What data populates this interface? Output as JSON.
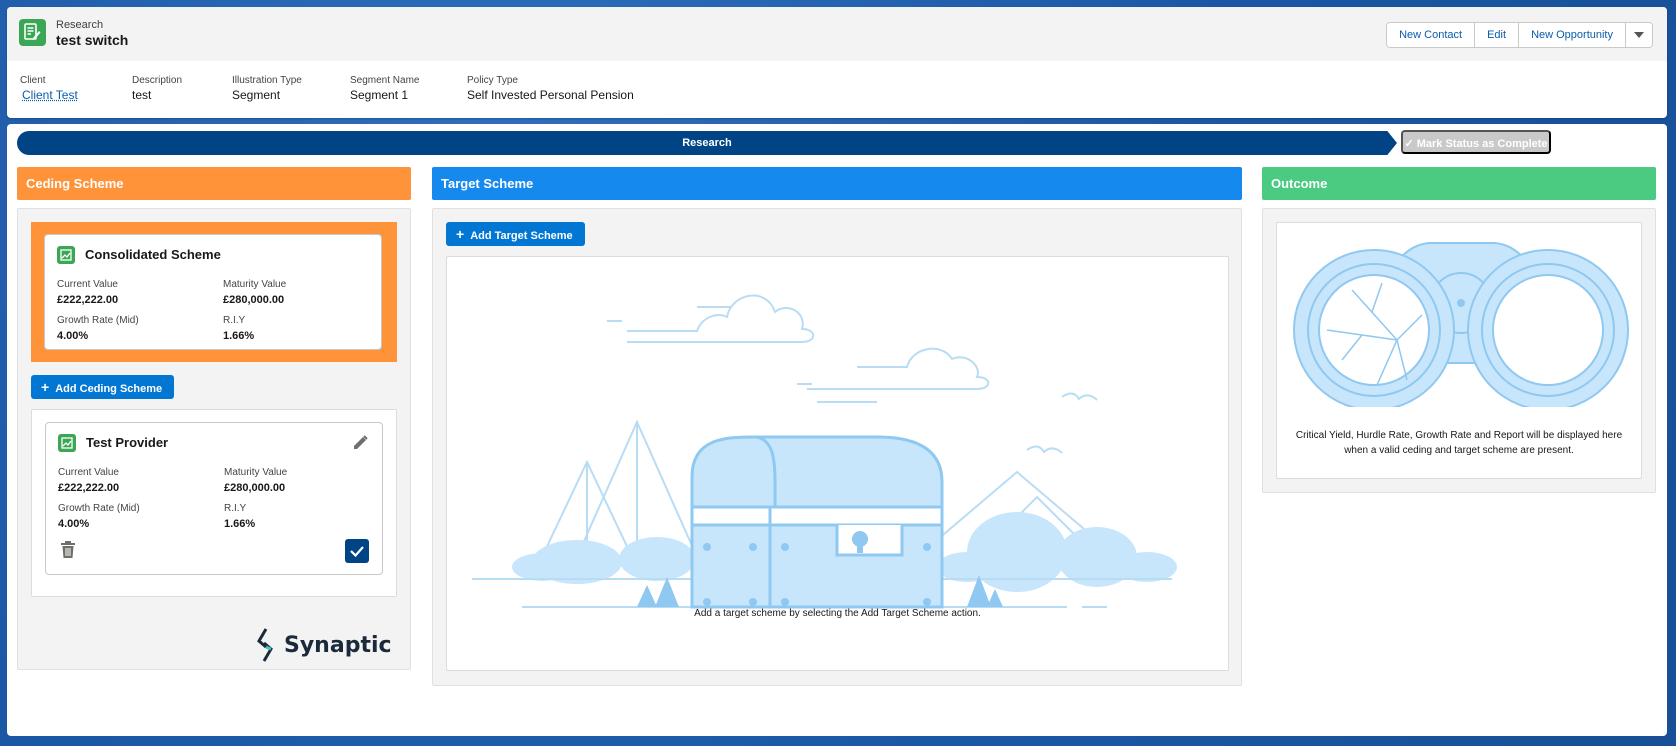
{
  "header": {
    "object_type": "Research",
    "record_name": "test switch",
    "actions": [
      "New Contact",
      "Edit",
      "New Opportunity"
    ],
    "fields": [
      {
        "label": "Client",
        "value": "Client Test"
      },
      {
        "label": "Description",
        "value": "test"
      },
      {
        "label": "Illustration Type",
        "value": "Segment"
      },
      {
        "label": "Segment Name",
        "value": "Segment 1"
      },
      {
        "label": "Policy Type",
        "value": "Self Invested Personal Pension"
      }
    ]
  },
  "path": {
    "current_stage": "Research",
    "mark_complete_label": "Mark Status as Complete"
  },
  "ceding": {
    "title": "Ceding Scheme",
    "add_label": "Add Ceding Scheme",
    "consolidated": {
      "title": "Consolidated Scheme",
      "current_value_label": "Current Value",
      "current_value": "£222,222.00",
      "maturity_value_label": "Maturity Value",
      "maturity_value": "£280,000.00",
      "growth_rate_label": "Growth Rate (Mid)",
      "growth_rate": "4.00%",
      "riy_label": "R.I.Y",
      "riy": "1.66%"
    },
    "provider": {
      "title": "Test Provider",
      "current_value_label": "Current Value",
      "current_value": "£222,222.00",
      "maturity_value_label": "Maturity Value",
      "maturity_value": "£280,000.00",
      "growth_rate_label": "Growth Rate (Mid)",
      "growth_rate": "4.00%",
      "riy_label": "R.I.Y",
      "riy": "1.66%"
    },
    "logo_text": "Synaptic"
  },
  "target": {
    "title": "Target Scheme",
    "add_label": "Add Target Scheme",
    "empty_message": "Add a target scheme by selecting the Add Target Scheme action."
  },
  "outcome": {
    "title": "Outcome",
    "message_line1": "Critical Yield, Hurdle Rate, Growth Rate and Report will be displayed here",
    "message_line2": "when a valid ceding and target scheme are present."
  },
  "colors": {
    "ceding_header": "#fe9339",
    "target_header": "#1589ee",
    "outcome_header": "#4bca81",
    "brand_blue": "#0176d3",
    "path_blue": "#014486"
  }
}
